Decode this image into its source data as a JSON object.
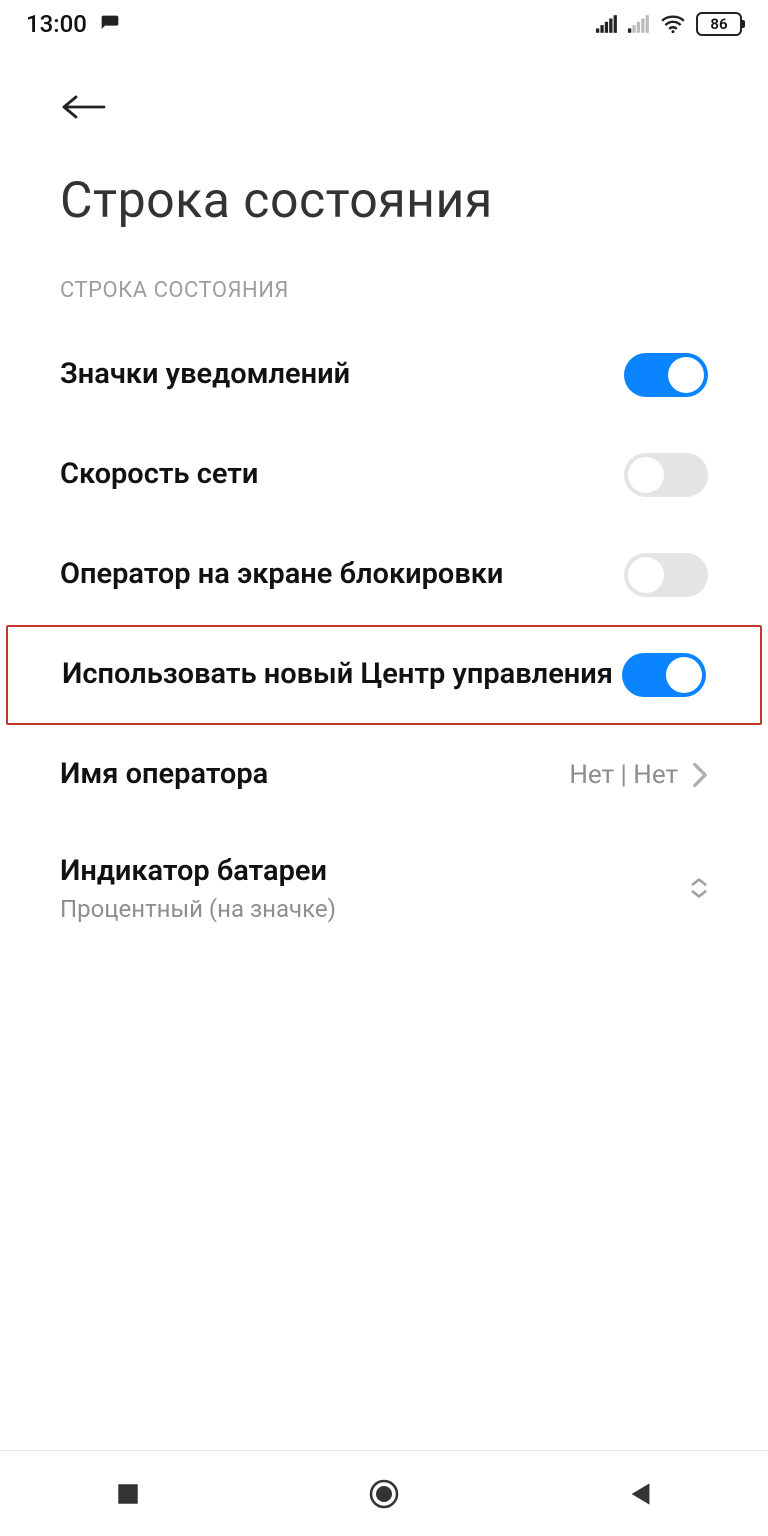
{
  "statusbar": {
    "time": "13:00",
    "battery": "86"
  },
  "header": {
    "title": "Строка состояния"
  },
  "section": {
    "label": "СТРОКА СОСТОЯНИЯ"
  },
  "rows": {
    "notification_icons": {
      "label": "Значки уведомлений",
      "toggle": true
    },
    "network_speed": {
      "label": "Скорость сети",
      "toggle": false
    },
    "carrier_lockscreen": {
      "label": "Оператор на экране блокировки",
      "toggle": false
    },
    "new_control_center": {
      "label": "Использовать новый Центр управления",
      "toggle": true
    },
    "carrier_name": {
      "label": "Имя оператора",
      "value": "Нет | Нет"
    },
    "battery_indicator": {
      "label": "Индикатор батареи",
      "sublabel": "Процентный (на значке)"
    }
  },
  "colors": {
    "accent": "#0a84ff",
    "highlight_border": "#c0392b"
  }
}
